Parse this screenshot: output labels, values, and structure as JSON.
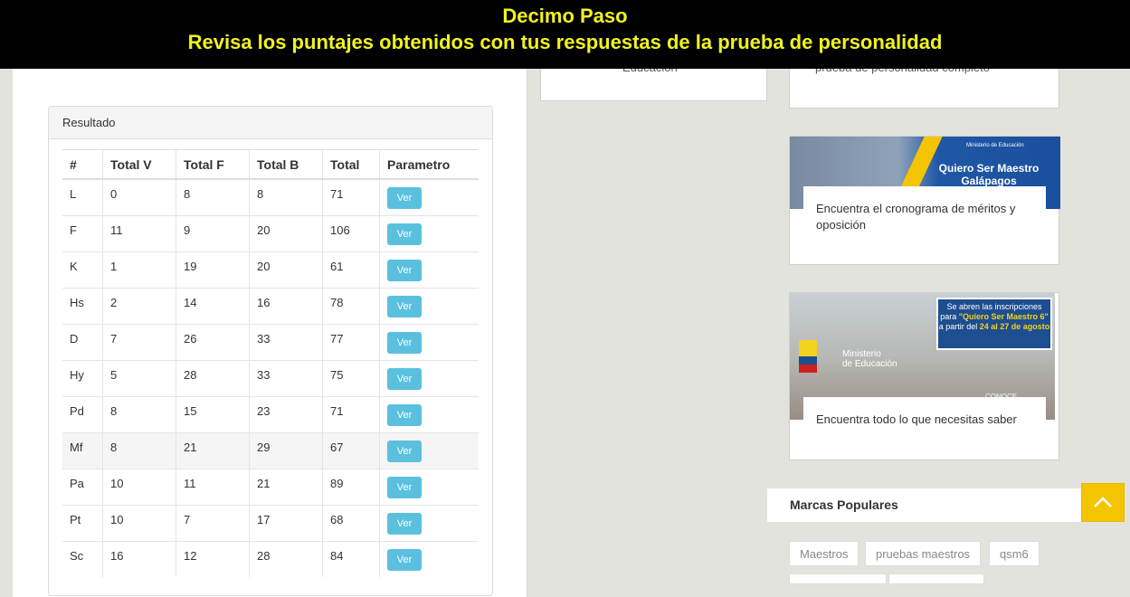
{
  "banner": {
    "line1": "Decimo Paso",
    "line2": "Revisa los puntajes obtenidos con tus respuestas de la prueba de personalidad"
  },
  "colors": {
    "banner_bg": "#000000",
    "banner_text": "#f0f31e",
    "ver_button": "#5bc0de",
    "back_to_top": "#f5c400"
  },
  "panel": {
    "title": "Resultado",
    "columns": [
      "#",
      "Total V",
      "Total F",
      "Total B",
      "Total",
      "Parametro"
    ],
    "rows": [
      {
        "id": "L",
        "v": "0",
        "f": "8",
        "b": "8",
        "total": "71",
        "btn": "Ver"
      },
      {
        "id": "F",
        "v": "11",
        "f": "9",
        "b": "20",
        "total": "106",
        "btn": "Ver"
      },
      {
        "id": "K",
        "v": "1",
        "f": "19",
        "b": "20",
        "total": "61",
        "btn": "Ver"
      },
      {
        "id": "Hs",
        "v": "2",
        "f": "14",
        "b": "16",
        "total": "78",
        "btn": "Ver"
      },
      {
        "id": "D",
        "v": "7",
        "f": "26",
        "b": "33",
        "total": "77",
        "btn": "Ver"
      },
      {
        "id": "Hy",
        "v": "5",
        "f": "28",
        "b": "33",
        "total": "75",
        "btn": "Ver"
      },
      {
        "id": "Pd",
        "v": "8",
        "f": "15",
        "b": "23",
        "total": "71",
        "btn": "Ver"
      },
      {
        "id": "Mf",
        "v": "8",
        "f": "21",
        "b": "29",
        "total": "67",
        "btn": "Ver"
      },
      {
        "id": "Pa",
        "v": "10",
        "f": "11",
        "b": "21",
        "total": "89",
        "btn": "Ver"
      },
      {
        "id": "Pt",
        "v": "10",
        "f": "7",
        "b": "17",
        "total": "68",
        "btn": "Ver"
      },
      {
        "id": "Sc",
        "v": "16",
        "f": "12",
        "b": "28",
        "total": "84",
        "btn": "Ver"
      }
    ]
  },
  "sidebar": {
    "mid_card_text": "Educación",
    "card1_text": "prueba de personalidad completo",
    "card2": {
      "image_title": "Quiero Ser Maestro",
      "image_subtitle": "Galápagos",
      "image_ministry": "Ministerio de Educación",
      "text": "Encuentra el cronograma de méritos y oposición"
    },
    "card3": {
      "ad_line1": "Se abren las inscripciones",
      "ad_line2": "para",
      "ad_highlight": "\"Quiero Ser Maestro 6\"",
      "ad_line3": "a partir del",
      "ad_dates": "24 al 27 de agosto",
      "ministry_line1": "Ministerio",
      "ministry_line2": "de Educación",
      "conoce": "CONOCE",
      "text": "Encuentra todo lo que necesitas saber"
    },
    "marcas_title": "Marcas Populares",
    "tags": [
      "Maestros",
      "pruebas maestros",
      "qsm6"
    ]
  }
}
